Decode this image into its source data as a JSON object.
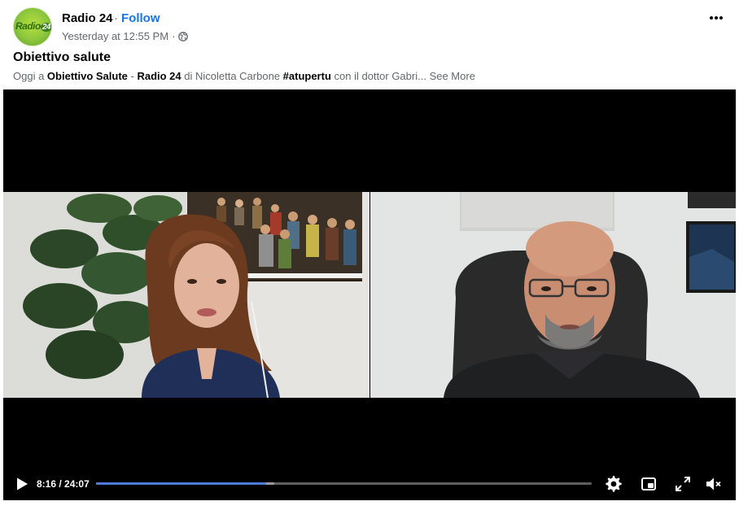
{
  "post": {
    "page_name": "Radio 24",
    "separator": "·",
    "follow_label": "Follow",
    "timestamp": "Yesterday at 12:55 PM",
    "timestamp_separator": "·",
    "avatar_logo_text": "Radio",
    "avatar_logo_number": "24",
    "title": "Obiettivo salute",
    "text_parts": {
      "p1": "Oggi a ",
      "b1": "Obiettivo Salute",
      "p2": " - ",
      "b2": "Radio 24",
      "p3": " di Nicoletta Carbone ",
      "hashtag": "#atupertu",
      "p4": " con il dottor Gabri... "
    },
    "see_more_label": "See More"
  },
  "video": {
    "current_time": "8:16",
    "total_time": "24:07",
    "time_separator": " / ",
    "progress_fraction": 0.343,
    "buffer_fraction": 0.36
  },
  "icons": {
    "more": "more-horizontal-icon",
    "privacy": "globe-icon",
    "play": "play-icon",
    "settings": "gear-icon",
    "pip": "picture-in-picture-icon",
    "fullscreen": "fullscreen-icon",
    "volume": "muted-volume-icon"
  },
  "colors": {
    "follow": "#1b74e4",
    "progress": "#4a7bd6",
    "video_bg": "#000000"
  }
}
